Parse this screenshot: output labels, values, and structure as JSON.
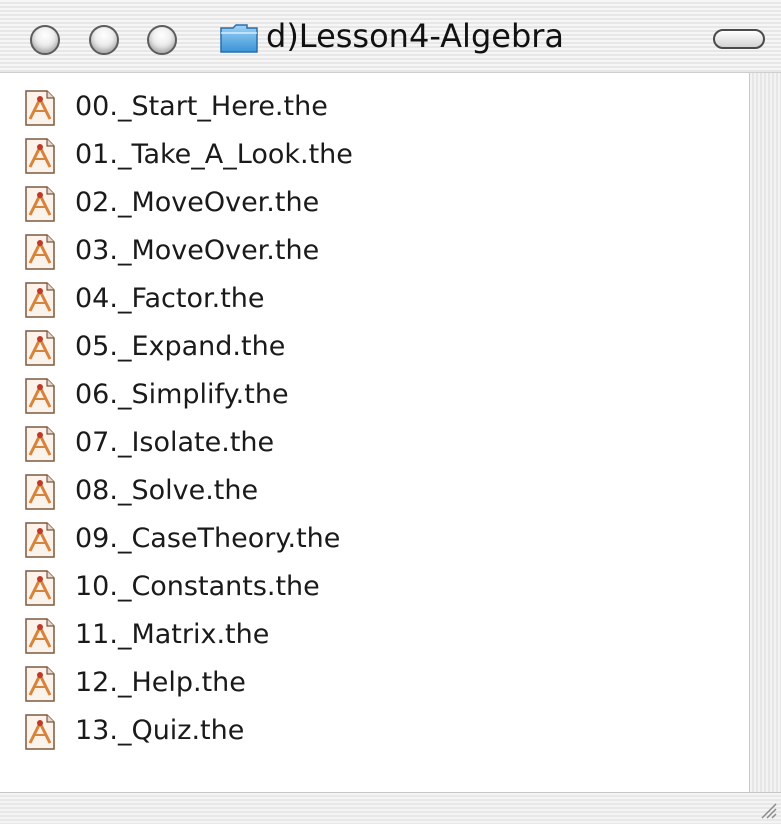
{
  "window": {
    "title": "d)Lesson4-Algebra",
    "title_icon": "folder-icon"
  },
  "titlebar_buttons": [
    "close",
    "minimize",
    "zoom"
  ],
  "files": [
    {
      "name": "00._Start_Here.the",
      "icon": "theorist-document-icon"
    },
    {
      "name": "01._Take_A_Look.the",
      "icon": "theorist-document-icon"
    },
    {
      "name": "02._MoveOver.the",
      "icon": "theorist-document-icon"
    },
    {
      "name": "03._MoveOver.the",
      "icon": "theorist-document-icon"
    },
    {
      "name": "04._Factor.the",
      "icon": "theorist-document-icon"
    },
    {
      "name": "05._Expand.the",
      "icon": "theorist-document-icon"
    },
    {
      "name": "06._Simplify.the",
      "icon": "theorist-document-icon"
    },
    {
      "name": "07._Isolate.the",
      "icon": "theorist-document-icon"
    },
    {
      "name": "08._Solve.the",
      "icon": "theorist-document-icon"
    },
    {
      "name": "09._CaseTheory.the",
      "icon": "theorist-document-icon"
    },
    {
      "name": "10._Constants.the",
      "icon": "theorist-document-icon"
    },
    {
      "name": "11._Matrix.the",
      "icon": "theorist-document-icon"
    },
    {
      "name": "12._Help.the",
      "icon": "theorist-document-icon"
    },
    {
      "name": "13._Quiz.the",
      "icon": "theorist-document-icon"
    }
  ],
  "colors": {
    "folder_blue": "#4aa6e8",
    "icon_orange": "#d9823a",
    "text": "#1a1a1a"
  }
}
